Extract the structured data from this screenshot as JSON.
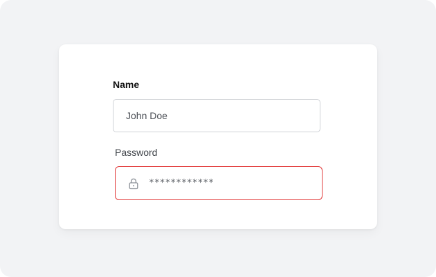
{
  "form": {
    "name_label": "Name",
    "name_value": "John Doe",
    "password_label": "Password",
    "password_value": "************",
    "password_icon": "lock-icon"
  },
  "colors": {
    "background": "#f2f3f5",
    "card": "#ffffff",
    "input_border": "#cfd2d6",
    "error_border": "#e23b3b"
  }
}
